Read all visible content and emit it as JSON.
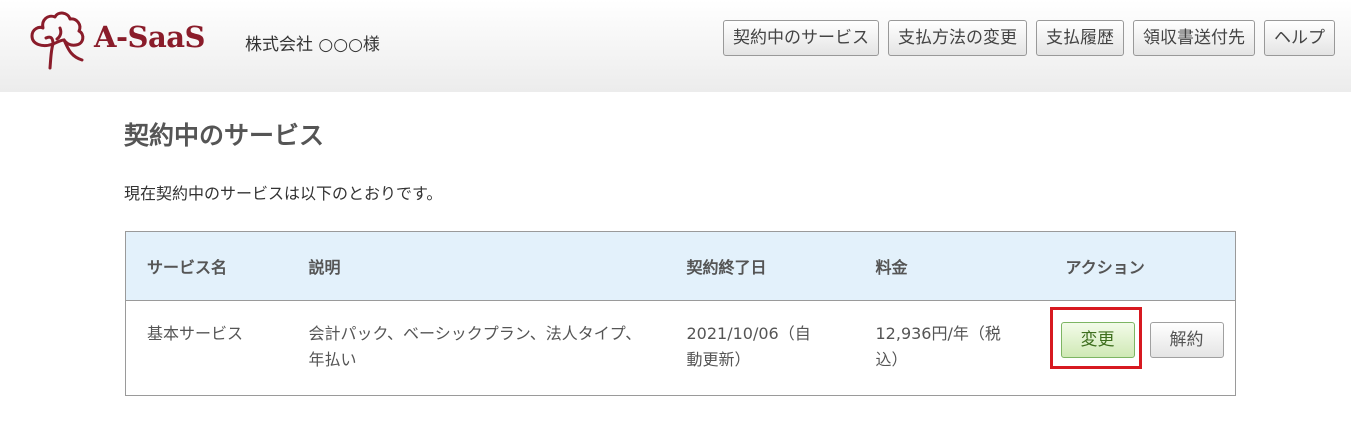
{
  "header": {
    "logo_text": "A-SaaS",
    "company_name": "株式会社 ○○○様",
    "nav": [
      {
        "label": "契約中のサービス"
      },
      {
        "label": "支払方法の変更"
      },
      {
        "label": "支払履歴"
      },
      {
        "label": "領収書送付先"
      },
      {
        "label": "ヘルプ"
      }
    ]
  },
  "main": {
    "title": "契約中のサービス",
    "intro": "現在契約中のサービスは以下のとおりです。",
    "table": {
      "headers": [
        "サービス名",
        "説明",
        "契約終了日",
        "料金",
        "アクション"
      ],
      "rows": [
        {
          "service": "基本サービス",
          "description": "会計パック、ベーシックプラン、法人タイプ、年払い",
          "end_date": "2021/10/06（自動更新）",
          "price": "12,936円/年（税込）",
          "actions": {
            "change": "変更",
            "cancel": "解約"
          }
        }
      ]
    }
  },
  "colors": {
    "brand": "#8a1c2a",
    "header_bg": "#e3f1fb",
    "highlight": "#d71920",
    "change_button": "#cfe9b5"
  }
}
